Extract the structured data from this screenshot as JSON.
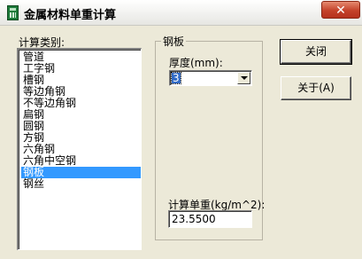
{
  "window": {
    "title": "金属材料单重计算",
    "close_glyph": "✕"
  },
  "calc_category": {
    "label": "计算类别:",
    "items": [
      {
        "label": "管道"
      },
      {
        "label": "工字钢"
      },
      {
        "label": "槽钢"
      },
      {
        "label": "等边角钢"
      },
      {
        "label": "不等边角钢"
      },
      {
        "label": "扁钢"
      },
      {
        "label": "圆钢"
      },
      {
        "label": "方钢"
      },
      {
        "label": "六角钢"
      },
      {
        "label": "六角中空钢"
      },
      {
        "label": "钢板"
      },
      {
        "label": "钢丝"
      }
    ],
    "selected_index": 10
  },
  "steel_plate": {
    "group_title": "钢板",
    "thickness_label": "厚度(mm):",
    "thickness_value": "3",
    "unit_weight_label": "计算单重(kg/m^2):",
    "unit_weight_value": "23.5500"
  },
  "buttons": {
    "close_label": "关闭",
    "about_label": "关于(A)"
  },
  "colors": {
    "selection": "#3399ff",
    "close_button": "#c4422a"
  }
}
